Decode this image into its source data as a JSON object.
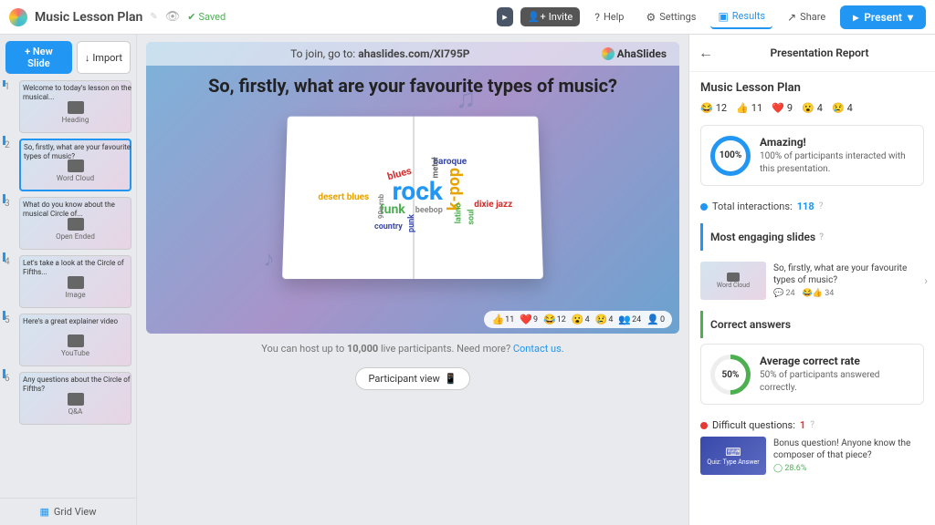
{
  "title": "Music Lesson Plan",
  "saved": "Saved",
  "topbar": {
    "invite": "Invite",
    "help": "Help",
    "settings": "Settings",
    "results": "Results",
    "share": "Share",
    "present": "Present"
  },
  "sidebar": {
    "new_slide": "+ New Slide",
    "import": "Import",
    "grid_view": "Grid View",
    "slides": [
      {
        "num": "1",
        "title": "Welcome to today's lesson on the musical...",
        "type": "Heading"
      },
      {
        "num": "2",
        "title": "So, firstly, what are your favourite types of music?",
        "type": "Word Cloud"
      },
      {
        "num": "3",
        "title": "What do you know about the musical Circle of...",
        "type": "Open Ended"
      },
      {
        "num": "4",
        "title": "Let's take a look at the Circle of Fifths...",
        "type": "Image"
      },
      {
        "num": "5",
        "title": "Here's a great explainer video",
        "type": "YouTube"
      },
      {
        "num": "6",
        "title": "Any questions about the Circle of Fifths?",
        "type": "Q&A"
      }
    ]
  },
  "canvas": {
    "join_prefix": "To join, go to: ",
    "join_link": "ahaslides.com/XI795P",
    "brand": "AhaSlides",
    "question": "So, firstly, what are your favourite types of music?",
    "words": {
      "rock": "rock",
      "kpop": "k-pop",
      "funk": "funk",
      "blues": "blues",
      "baroque": "baroque",
      "metal": "metal",
      "beebop": "beebop",
      "country": "country",
      "desert": "desert blues",
      "dixie": "dixie jazz",
      "latino": "latino",
      "soul": "soul",
      "punk": "punk",
      "rnb": "90s rnb"
    },
    "reactions": [
      {
        "icon": "👍",
        "n": "11"
      },
      {
        "icon": "❤️",
        "n": "9"
      },
      {
        "icon": "😂",
        "n": "12"
      },
      {
        "icon": "😮",
        "n": "4"
      },
      {
        "icon": "😢",
        "n": "4"
      },
      {
        "icon": "👥",
        "n": "24"
      },
      {
        "icon": "👤",
        "n": "0"
      }
    ],
    "host_note_pre": "You can host up to ",
    "host_note_bold": "10,000",
    "host_note_post": " live participants. Need more? ",
    "contact": "Contact us.",
    "participant_view": "Participant view"
  },
  "report": {
    "title": "Presentation Report",
    "plan": "Music Lesson Plan",
    "reactions": [
      {
        "icon": "😂",
        "n": "12"
      },
      {
        "icon": "👍",
        "n": "11"
      },
      {
        "icon": "❤️",
        "n": "9"
      },
      {
        "icon": "😮",
        "n": "4"
      },
      {
        "icon": "😢",
        "n": "4"
      }
    ],
    "amazing": "Amazing!",
    "amazing_txt": "100% of participants interacted with this presentation.",
    "pct100": "100%",
    "total_label": "Total interactions: ",
    "total_n": "118",
    "engaging_h": "Most engaging slides",
    "eng_title": "So, firstly, what are your favourite types of music?",
    "eng_type": "Word Cloud",
    "eng_c": "24",
    "eng_l": "34",
    "correct_h": "Correct answers",
    "avg_label": "Average correct rate",
    "avg_txt": "50% of participants answered correctly.",
    "pct50": "50%",
    "diff_label": "Difficult questions: ",
    "diff_n": "1",
    "diff_title": "Bonus question! Anyone know the composer of that piece?",
    "diff_type": "Quiz: Type Answer",
    "diff_pct": "28.6%"
  }
}
